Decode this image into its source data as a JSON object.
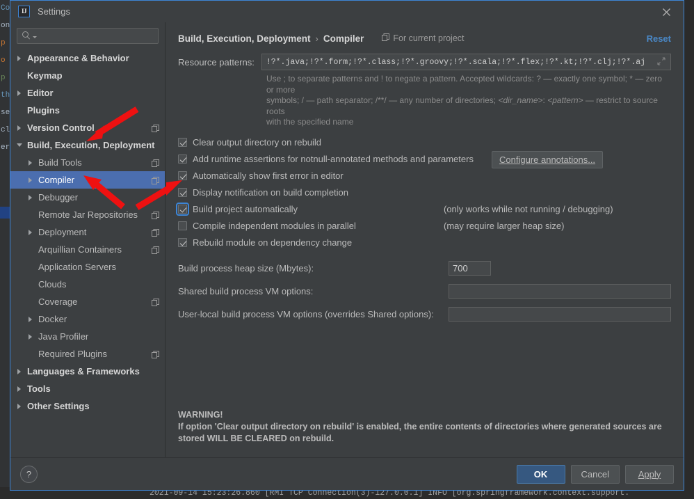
{
  "window": {
    "title": "Settings",
    "logo_icon": "intellij-idea-logo-icon",
    "close_icon": "close-icon"
  },
  "sidebar": {
    "search": {
      "placeholder": "",
      "value": "",
      "icon": "search-icon"
    },
    "items": [
      {
        "label": "Appearance & Behavior",
        "indent": 0,
        "arrow": "right",
        "bold": true,
        "module_icon": false,
        "selected": false
      },
      {
        "label": "Keymap",
        "indent": 0,
        "arrow": "none",
        "bold": true,
        "module_icon": false,
        "selected": false
      },
      {
        "label": "Editor",
        "indent": 0,
        "arrow": "right",
        "bold": true,
        "module_icon": false,
        "selected": false
      },
      {
        "label": "Plugins",
        "indent": 0,
        "arrow": "none",
        "bold": true,
        "module_icon": false,
        "selected": false
      },
      {
        "label": "Version Control",
        "indent": 0,
        "arrow": "right",
        "bold": true,
        "module_icon": true,
        "selected": false
      },
      {
        "label": "Build, Execution, Deployment",
        "indent": 0,
        "arrow": "down",
        "bold": true,
        "module_icon": false,
        "selected": false
      },
      {
        "label": "Build Tools",
        "indent": 1,
        "arrow": "right",
        "bold": false,
        "module_icon": true,
        "selected": false
      },
      {
        "label": "Compiler",
        "indent": 1,
        "arrow": "right",
        "bold": false,
        "module_icon": true,
        "selected": true
      },
      {
        "label": "Debugger",
        "indent": 1,
        "arrow": "right",
        "bold": false,
        "module_icon": false,
        "selected": false
      },
      {
        "label": "Remote Jar Repositories",
        "indent": 1,
        "arrow": "none",
        "bold": false,
        "module_icon": true,
        "selected": false
      },
      {
        "label": "Deployment",
        "indent": 1,
        "arrow": "right",
        "bold": false,
        "module_icon": true,
        "selected": false
      },
      {
        "label": "Arquillian Containers",
        "indent": 1,
        "arrow": "none",
        "bold": false,
        "module_icon": true,
        "selected": false
      },
      {
        "label": "Application Servers",
        "indent": 1,
        "arrow": "none",
        "bold": false,
        "module_icon": false,
        "selected": false
      },
      {
        "label": "Clouds",
        "indent": 1,
        "arrow": "none",
        "bold": false,
        "module_icon": false,
        "selected": false
      },
      {
        "label": "Coverage",
        "indent": 1,
        "arrow": "none",
        "bold": false,
        "module_icon": true,
        "selected": false
      },
      {
        "label": "Docker",
        "indent": 1,
        "arrow": "right",
        "bold": false,
        "module_icon": false,
        "selected": false
      },
      {
        "label": "Java Profiler",
        "indent": 1,
        "arrow": "right",
        "bold": false,
        "module_icon": false,
        "selected": false
      },
      {
        "label": "Required Plugins",
        "indent": 1,
        "arrow": "none",
        "bold": false,
        "module_icon": true,
        "selected": false
      },
      {
        "label": "Languages & Frameworks",
        "indent": 0,
        "arrow": "right",
        "bold": true,
        "module_icon": false,
        "selected": false
      },
      {
        "label": "Tools",
        "indent": 0,
        "arrow": "right",
        "bold": true,
        "module_icon": false,
        "selected": false
      },
      {
        "label": "Other Settings",
        "indent": 0,
        "arrow": "right",
        "bold": true,
        "module_icon": false,
        "selected": false
      }
    ]
  },
  "content": {
    "breadcrumb_root": "Build, Execution, Deployment",
    "breadcrumb_sep": "›",
    "breadcrumb_leaf": "Compiler",
    "for_current_project": "For current project",
    "for_current_project_icon": "module-icon",
    "reset_label": "Reset",
    "resource_patterns_label": "Resource patterns:",
    "resource_patterns_value": "!?*.java;!?*.form;!?*.class;!?*.groovy;!?*.scala;!?*.flex;!?*.kt;!?*.clj;!?*.aj",
    "expand_icon": "expand-icon",
    "hint_line1": "Use ; to separate patterns and ! to negate a pattern. Accepted wildcards: ? — exactly one symbol; * — zero or more",
    "hint_line2a": "symbols; / — path separator; /**/ — any number of directories; ",
    "hint_line2b": "<dir_name>",
    "hint_line2c": ": ",
    "hint_line2d": "<pattern>",
    "hint_line2e": " — restrict to source roots",
    "hint_line3": "with the specified name",
    "checkboxes": [
      {
        "label": "Clear output directory on rebuild",
        "checked": true,
        "focused": false,
        "note": ""
      },
      {
        "label": "Add runtime assertions for notnull-annotated methods and parameters",
        "checked": true,
        "focused": false,
        "note": ""
      },
      {
        "label": "Automatically show first error in editor",
        "checked": true,
        "focused": false,
        "note": ""
      },
      {
        "label": "Display notification on build completion",
        "checked": true,
        "focused": false,
        "note": ""
      },
      {
        "label": "Build project automatically",
        "checked": true,
        "focused": true,
        "note": "(only works while not running / debugging)"
      },
      {
        "label": "Compile independent modules in parallel",
        "checked": false,
        "focused": false,
        "note": "(may require larger heap size)"
      },
      {
        "label": "Rebuild module on dependency change",
        "checked": true,
        "focused": false,
        "note": ""
      }
    ],
    "configure_annotations_label": "Configure annotations...",
    "heap_label": "Build process heap size (Mbytes):",
    "heap_value": "700",
    "shared_vm_label": "Shared build process VM options:",
    "shared_vm_value": "",
    "userlocal_vm_label": "User-local build process VM options (overrides Shared options):",
    "userlocal_vm_value": "",
    "warning_title": "WARNING!",
    "warning_line1": "If option 'Clear output directory on rebuild' is enabled, the entire contents of directories where generated sources are",
    "warning_line2": "stored WILL BE CLEARED on rebuild."
  },
  "footer": {
    "help_label": "?",
    "ok_label": "OK",
    "cancel_label": "Cancel",
    "apply_label": "Apply"
  },
  "background": {
    "console_line": "2021-09-14 15:23:26.860 [RMI TCP Connection(3)-127.0.0.1] INFO  [org.springframework.context.support."
  },
  "colors": {
    "dialog_bg": "#3c3f41",
    "selection_blue": "#4b6eaf",
    "accent_border": "#3d85d6",
    "link_blue": "#4a88c7",
    "primary_button": "#365880",
    "annotation_red": "#ee1111"
  }
}
